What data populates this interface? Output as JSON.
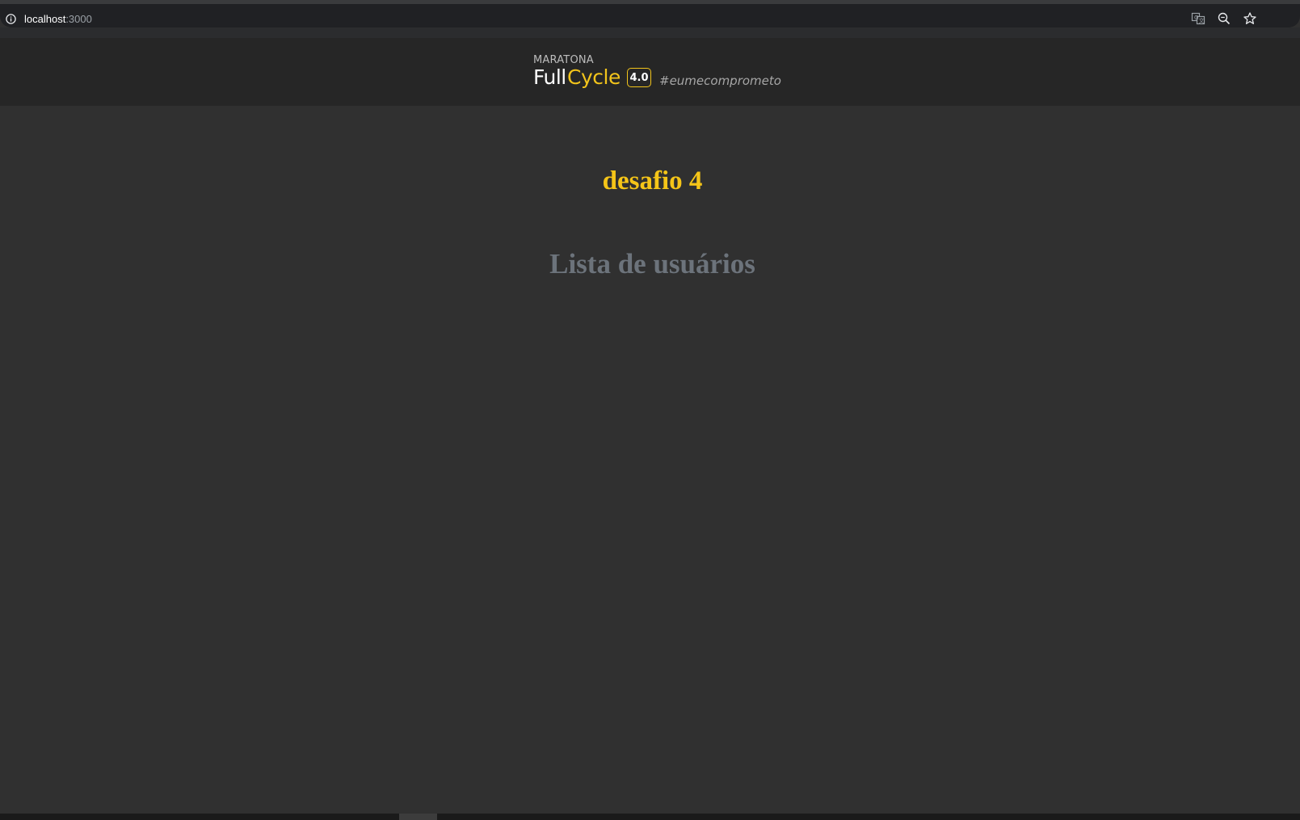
{
  "browser": {
    "url_host": "localhost",
    "url_port": ":3000",
    "icons": [
      "info-icon",
      "translate-icon",
      "zoom-icon",
      "bookmark-star-icon"
    ]
  },
  "header": {
    "logo": {
      "kicker": "MARATONA",
      "word_full": "Full",
      "word_cycle": "Cycle",
      "version": "4.0",
      "hashtag": "#eumecomprometo"
    },
    "colors": {
      "accent": "#f2c41b",
      "background": "#262626"
    }
  },
  "main": {
    "title": "desafio 4",
    "subtitle": "Lista de usuários",
    "users": [],
    "colors": {
      "title": "#f5c518",
      "subtitle": "#6c737b",
      "background": "#303030"
    }
  }
}
